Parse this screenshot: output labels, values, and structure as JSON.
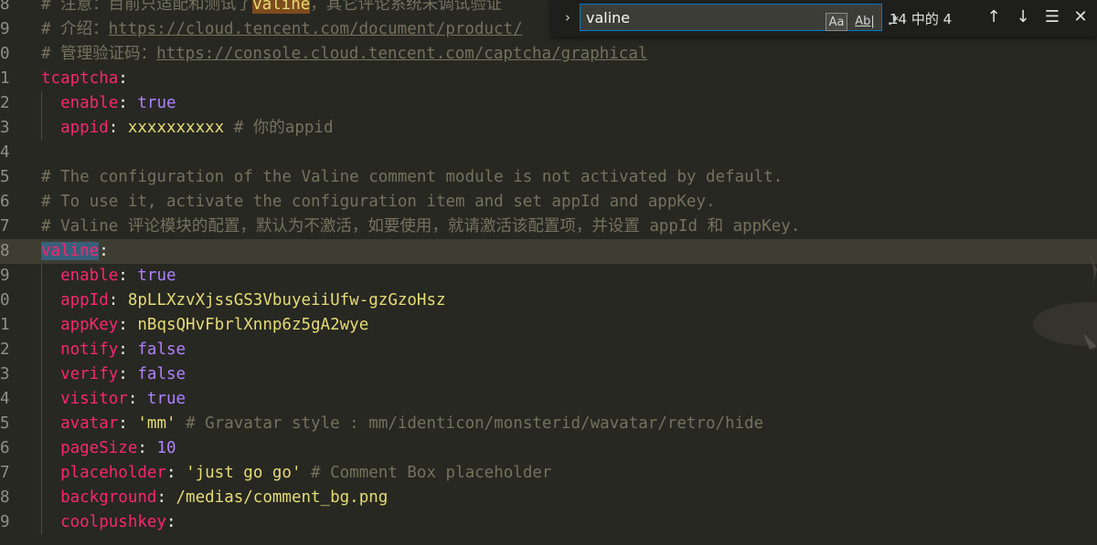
{
  "editor": {
    "lines": [
      {
        "n": "8",
        "parts": [
          {
            "t": "# 注意：目前只适配和测试了",
            "c": "cm"
          },
          {
            "t": "valine",
            "c": "match"
          },
          {
            "t": "，其它评论系统未调试验证",
            "c": "cm"
          }
        ]
      },
      {
        "n": "9",
        "parts": [
          {
            "t": "# 介绍：",
            "c": "cm"
          },
          {
            "t": "https://cloud.tencent.com/document/product/",
            "c": "cm url"
          }
        ]
      },
      {
        "n": "0",
        "parts": [
          {
            "t": "# 管理验证码：",
            "c": "cm"
          },
          {
            "t": "https://console.cloud.tencent.com/captcha/graphical",
            "c": "cm url"
          }
        ]
      },
      {
        "n": "1",
        "parts": [
          {
            "t": "tcaptcha",
            "c": "key"
          },
          {
            "t": ":",
            "c": "pl"
          }
        ]
      },
      {
        "n": "2",
        "guide": true,
        "parts": [
          {
            "t": "  "
          },
          {
            "t": "enable",
            "c": "key"
          },
          {
            "t": ": ",
            "c": "pl"
          },
          {
            "t": "true",
            "c": "con"
          }
        ]
      },
      {
        "n": "3",
        "guide": true,
        "parts": [
          {
            "t": "  "
          },
          {
            "t": "appid",
            "c": "key"
          },
          {
            "t": ": ",
            "c": "pl"
          },
          {
            "t": "xxxxxxxxxx",
            "c": "str"
          },
          {
            "t": " # 你的appid",
            "c": "cm"
          }
        ]
      },
      {
        "n": "4",
        "parts": []
      },
      {
        "n": "5",
        "parts": [
          {
            "t": "# The configuration of the Valine comment module is not activated by default.",
            "c": "cm"
          }
        ]
      },
      {
        "n": "6",
        "parts": [
          {
            "t": "# To use it, activate the configuration item and set appId and appKey.",
            "c": "cm"
          }
        ]
      },
      {
        "n": "7",
        "parts": [
          {
            "t": "# Valine 评论模块的配置，默认为不激活，如要使用，就请激活该配置项，并设置 appId 和 appKey.",
            "c": "cm"
          }
        ]
      },
      {
        "n": "8",
        "current": true,
        "parts": [
          {
            "t": "valine",
            "c": "key match-cur"
          },
          {
            "t": ":",
            "c": "pl"
          }
        ]
      },
      {
        "n": "9",
        "guide": true,
        "parts": [
          {
            "t": "  "
          },
          {
            "t": "enable",
            "c": "key"
          },
          {
            "t": ": ",
            "c": "pl"
          },
          {
            "t": "true",
            "c": "con"
          }
        ]
      },
      {
        "n": "0",
        "guide": true,
        "parts": [
          {
            "t": "  "
          },
          {
            "t": "appId",
            "c": "key"
          },
          {
            "t": ": ",
            "c": "pl"
          },
          {
            "t": "8pLLXzvXjssGS3VbuyeiiUfw-gzGzoHsz",
            "c": "str"
          }
        ]
      },
      {
        "n": "1",
        "guide": true,
        "parts": [
          {
            "t": "  "
          },
          {
            "t": "appKey",
            "c": "key"
          },
          {
            "t": ": ",
            "c": "pl"
          },
          {
            "t": "nBqsQHvFbrlXnnp6z5gA2wye",
            "c": "str"
          }
        ]
      },
      {
        "n": "2",
        "guide": true,
        "parts": [
          {
            "t": "  "
          },
          {
            "t": "notify",
            "c": "key"
          },
          {
            "t": ": ",
            "c": "pl"
          },
          {
            "t": "false",
            "c": "con"
          }
        ]
      },
      {
        "n": "3",
        "guide": true,
        "parts": [
          {
            "t": "  "
          },
          {
            "t": "verify",
            "c": "key"
          },
          {
            "t": ": ",
            "c": "pl"
          },
          {
            "t": "false",
            "c": "con"
          }
        ]
      },
      {
        "n": "4",
        "guide": true,
        "parts": [
          {
            "t": "  "
          },
          {
            "t": "visitor",
            "c": "key"
          },
          {
            "t": ": ",
            "c": "pl"
          },
          {
            "t": "true",
            "c": "con"
          }
        ]
      },
      {
        "n": "5",
        "guide": true,
        "parts": [
          {
            "t": "  "
          },
          {
            "t": "avatar",
            "c": "key"
          },
          {
            "t": ": ",
            "c": "pl"
          },
          {
            "t": "'mm'",
            "c": "str"
          },
          {
            "t": " # Gravatar style : mm/identicon/monsterid/wavatar/retro/hide",
            "c": "cm"
          }
        ]
      },
      {
        "n": "6",
        "guide": true,
        "parts": [
          {
            "t": "  "
          },
          {
            "t": "pageSize",
            "c": "key"
          },
          {
            "t": ": ",
            "c": "pl"
          },
          {
            "t": "10",
            "c": "con"
          }
        ]
      },
      {
        "n": "7",
        "guide": true,
        "parts": [
          {
            "t": "  "
          },
          {
            "t": "placeholder",
            "c": "key"
          },
          {
            "t": ": ",
            "c": "pl"
          },
          {
            "t": "'just go go'",
            "c": "str"
          },
          {
            "t": " # Comment Box placeholder",
            "c": "cm"
          }
        ]
      },
      {
        "n": "8",
        "guide": true,
        "parts": [
          {
            "t": "  "
          },
          {
            "t": "background",
            "c": "key"
          },
          {
            "t": ": ",
            "c": "pl"
          },
          {
            "t": "/medias/comment_bg.png",
            "c": "str"
          }
        ]
      },
      {
        "n": "9",
        "guide": true,
        "parts": [
          {
            "t": "  "
          },
          {
            "t": "coolpushkey",
            "c": "key"
          },
          {
            "t": ":",
            "c": "pl"
          }
        ]
      }
    ]
  },
  "find": {
    "toggle_icon": "chevron-right-icon",
    "query": "valine",
    "match_case_label": "Aa",
    "whole_word_label": "Ab|",
    "regex_label": ".*",
    "count": "14 中的 4",
    "prev_icon": "arrow-up-icon",
    "next_icon": "arrow-down-icon",
    "selection_icon": "find-in-selection-icon",
    "close_icon": "close-icon"
  },
  "colors": {
    "background": "#272822",
    "comment": "#75715e",
    "key": "#f92672",
    "string": "#e6db74",
    "constant": "#ae81ff",
    "match_highlight": "#7d4b1e",
    "current_match": "#3a5f7a"
  }
}
